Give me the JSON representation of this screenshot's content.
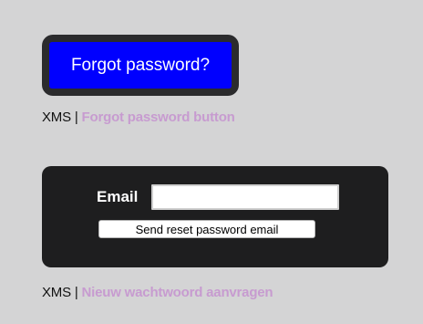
{
  "forgot_section": {
    "button_label": "Forgot password?",
    "button_color": "#0000ff",
    "caption_prefix": "XMS",
    "caption_separator": "|",
    "caption_title": "Forgot password button"
  },
  "reset_section": {
    "email_label": "Email",
    "email_value": "",
    "send_button_label": "Send reset password email",
    "caption_prefix": "XMS",
    "caption_separator": "|",
    "caption_title": "Nieuw wachtwoord aanvragen"
  },
  "colors": {
    "background": "#d4d4d5",
    "caption_accent": "#c79bd0",
    "panel_dark": "#1e1e1f"
  }
}
